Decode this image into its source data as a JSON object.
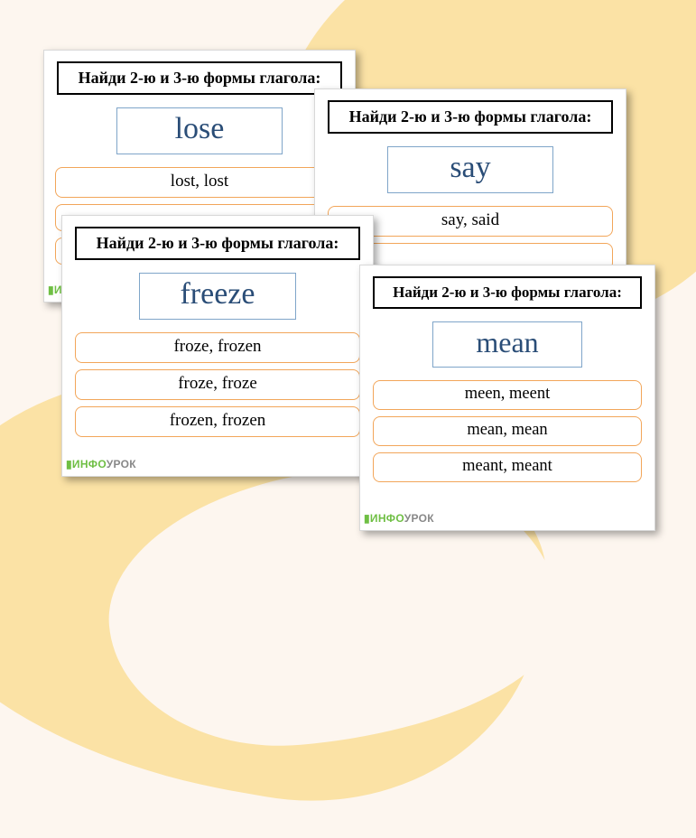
{
  "title_text": "Найди 2-ю и 3-ю формы глагола:",
  "watermark": {
    "info": "ИНФО",
    "urok": "УРОК"
  },
  "cards": [
    {
      "verb": "lose",
      "options": [
        "lost, lost"
      ]
    },
    {
      "verb": "say",
      "options": [
        "say, said"
      ]
    },
    {
      "verb": "freeze",
      "options": [
        "froze, frozen",
        "froze, froze",
        "frozen, frozen"
      ]
    },
    {
      "verb": "mean",
      "options": [
        "meen, meent",
        "mean, mean",
        "meant, meant"
      ]
    }
  ]
}
